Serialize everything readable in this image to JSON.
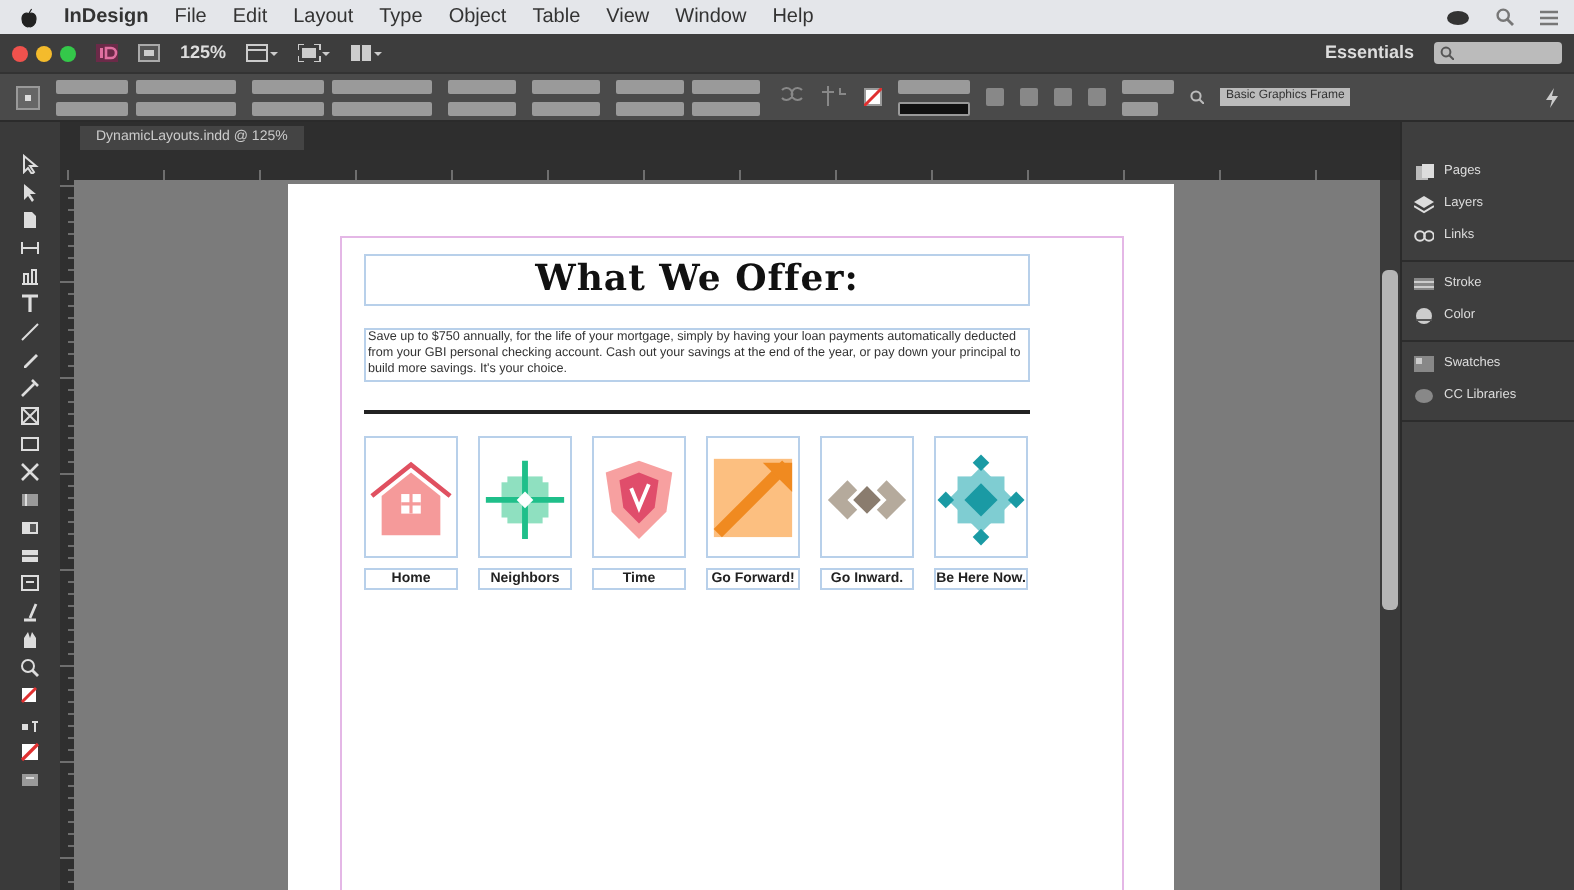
{
  "menu_bar": {
    "app_name": "InDesign",
    "items": [
      "File",
      "Edit",
      "Layout",
      "Type",
      "Object",
      "Table",
      "View",
      "Window",
      "Help"
    ]
  },
  "app_bar": {
    "zoom": "125%",
    "workspace": "Essentials"
  },
  "control_panel": {
    "object_style": "Basic Graphics Frame"
  },
  "document_tab": {
    "title": "DynamicLayouts.indd @ 125%"
  },
  "page": {
    "heading": "What We Offer:",
    "body": "Save up to $750 annually, for the life of your mortgage, simply by having your loan payments automatically deducted from your GBI personal checking account. Cash out your savings at the end of the year, or pay down your principal to build more savings. It's your choice.",
    "tiles": [
      {
        "label": "Home",
        "kind": "house"
      },
      {
        "label": "Neighbors",
        "kind": "cross"
      },
      {
        "label": "Time",
        "kind": "shield"
      },
      {
        "label": "Go Forward!",
        "kind": "arrow"
      },
      {
        "label": "Go Inward.",
        "kind": "chevrons"
      },
      {
        "label": "Be Here Now.",
        "kind": "diamonds"
      }
    ]
  },
  "panel_groups": [
    [
      {
        "label": "Pages",
        "kind": "pages"
      },
      {
        "label": "Layers",
        "kind": "layers"
      },
      {
        "label": "Links",
        "kind": "links"
      }
    ],
    [
      {
        "label": "Stroke",
        "kind": "stroke"
      },
      {
        "label": "Color",
        "kind": "color"
      }
    ],
    [
      {
        "label": "Swatches",
        "kind": "swatches"
      },
      {
        "label": "CC Libraries",
        "kind": "cc"
      }
    ]
  ]
}
